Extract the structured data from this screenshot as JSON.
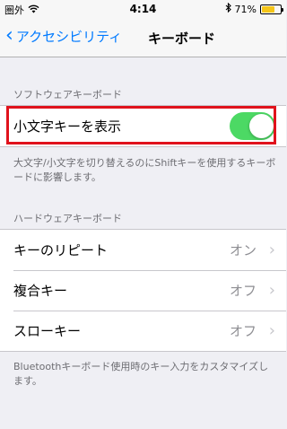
{
  "status_bar": {
    "carrier": "圏外",
    "wifi_icon": "wifi-icon",
    "time": "4:14",
    "bluetooth_icon": "bluetooth-icon",
    "battery_text": "71%",
    "battery_level": 0.71,
    "battery_color": "#f5c518"
  },
  "nav": {
    "back_label": "アクセシビリティ",
    "title": "キーボード",
    "accent_color": "#007aff"
  },
  "software_section": {
    "header": "ソフトウェアキーボード",
    "toggle_label": "小文字キーを表示",
    "toggle_on": true,
    "toggle_color": "#4cd964",
    "footer": "大文字/小文字を切り替えるのにShiftキーを使用するキーボードに影響します。"
  },
  "hardware_section": {
    "header": "ハードウェアキーボード",
    "rows": [
      {
        "label": "キーのリピート",
        "value": "オン"
      },
      {
        "label": "複合キー",
        "value": "オフ"
      },
      {
        "label": "スローキー",
        "value": "オフ"
      }
    ],
    "footer": "Bluetoothキーボード使用時のキー入力をカスタマイズします。"
  },
  "highlight_color": "#e0121c"
}
